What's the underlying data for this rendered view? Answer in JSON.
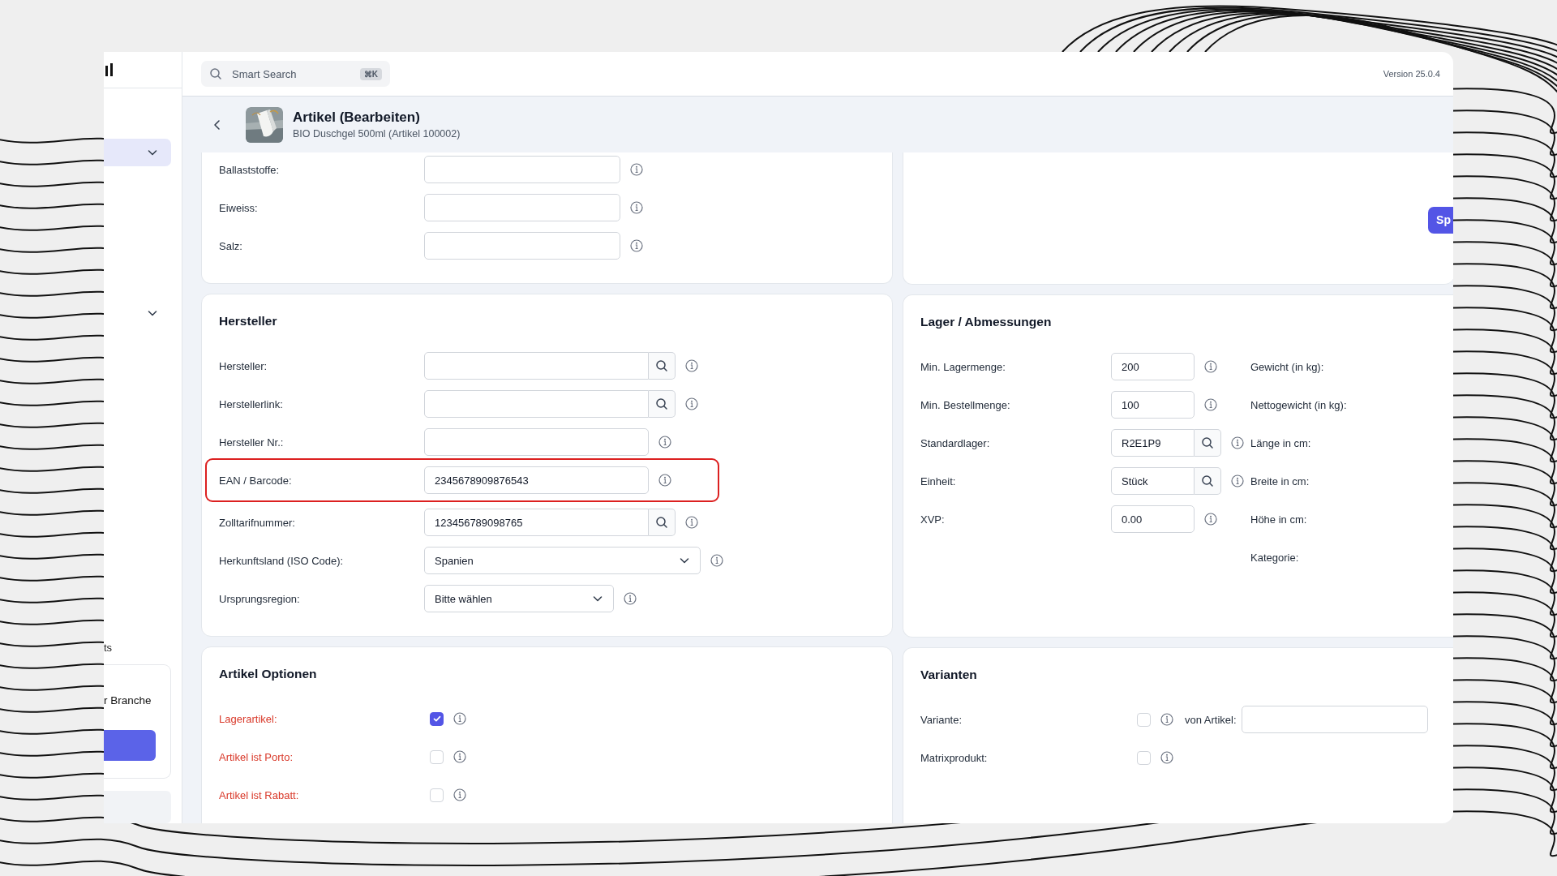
{
  "topbar": {
    "search": {
      "placeholder": "Smart Search",
      "shortcut": "⌘K"
    },
    "version": "Version 25.0.4"
  },
  "sidebar": {
    "menu_toggles": [
      {
        "selected": true
      },
      {
        "selected": false
      }
    ],
    "section_label": "ts",
    "promo": {
      "text": "r Branche"
    }
  },
  "header": {
    "title": "Artikel (Bearbeiten)",
    "subtitle": "BIO Duschgel 500ml (Artikel 100002)"
  },
  "columns": [
    {
      "cards": [
        {
          "rows": [
            {
              "kind": "text",
              "label": "Ballaststoffe:",
              "value": ""
            },
            {
              "kind": "text",
              "label": "Eiweiss:",
              "value": ""
            },
            {
              "kind": "text",
              "label": "Salz:",
              "value": ""
            }
          ]
        },
        {
          "title": "Hersteller",
          "rows": [
            {
              "kind": "search",
              "label": "Hersteller:",
              "value": "",
              "marked": false
            },
            {
              "kind": "search",
              "label": "Herstellerlink:",
              "value": "",
              "marked": false
            },
            {
              "kind": "text",
              "label": "Hersteller Nr.:",
              "value": "",
              "marked": false
            },
            {
              "kind": "text",
              "label": "EAN / Barcode:",
              "value": "2345678909876543",
              "marked": true
            },
            {
              "kind": "search",
              "label": "Zolltarifnummer:",
              "value": "123456789098765",
              "marked": false
            },
            {
              "kind": "select",
              "label": "Herkunftsland (ISO Code):",
              "value": "Spanien",
              "marked": false
            },
            {
              "kind": "select",
              "label": "Ursprungsregion:",
              "value": "Bitte wählen",
              "marked": false
            }
          ]
        },
        {
          "title": "Artikel Optionen",
          "rows": [
            {
              "kind": "checkbox",
              "label": "Lagerartikel:",
              "checked": true,
              "required": true
            },
            {
              "kind": "checkbox",
              "label": "Artikel ist Porto:",
              "checked": false,
              "required": true
            },
            {
              "kind": "checkbox",
              "label": "Artikel ist Rabatt:",
              "checked": false,
              "required": true
            }
          ]
        }
      ]
    },
    {
      "cards": [
        {
          "action": "Sp"
        },
        {
          "title": "Lager / Abmessungen",
          "rows": [
            {
              "kind": "text",
              "label": "Min. Lagermenge:",
              "value": "200"
            },
            {
              "kind": "text",
              "label": "Min. Bestellmenge:",
              "value": "100"
            },
            {
              "kind": "search",
              "label": "Standardlager:",
              "value": "R2E1P9"
            },
            {
              "kind": "search",
              "label": "Einheit:",
              "value": "Stück"
            },
            {
              "kind": "text",
              "label": "XVP:",
              "value": "0.00"
            }
          ],
          "side_labels": [
            "Gewicht (in kg):",
            "Nettogewicht (in kg):",
            "Länge in cm:",
            "Breite in cm:",
            "Höhe in cm:",
            "Kategorie:"
          ]
        },
        {
          "title": "Varianten",
          "rows": [
            {
              "kind": "checkbox",
              "label": "Variante:",
              "checked": false,
              "required": false,
              "linked": {
                "label": "von Artikel:"
              }
            },
            {
              "kind": "checkbox",
              "label": "Matrixprodukt:",
              "checked": false,
              "required": false
            }
          ]
        }
      ]
    }
  ]
}
